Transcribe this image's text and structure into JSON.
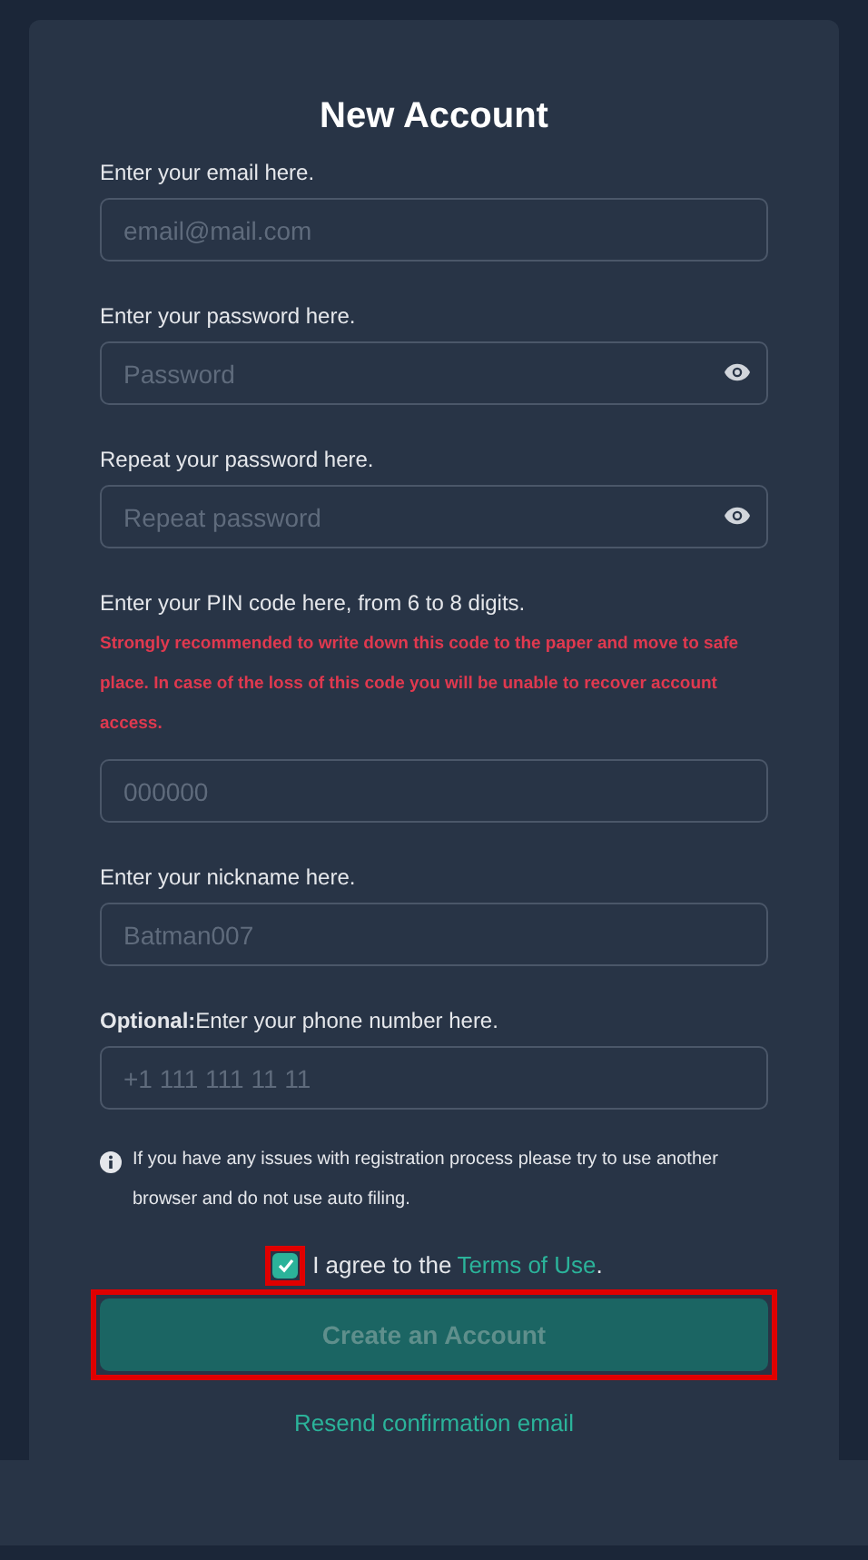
{
  "title": "New Account",
  "fields": [
    {
      "label": "Enter your email here.",
      "placeholder": "email@mail.com",
      "kind": "text"
    },
    {
      "label": "Enter your password here.",
      "placeholder": "Password",
      "kind": "password"
    },
    {
      "label": "Repeat your password here.",
      "placeholder": "Repeat password",
      "kind": "password"
    },
    {
      "label": "Enter your PIN code here, from 6 to 8 digits.",
      "warning": "Strongly recommended to write down this code to the paper and move to safe place. In case of the loss of this code you will be unable to recover account access.",
      "placeholder": "000000",
      "kind": "text"
    },
    {
      "label": "Enter your nickname here.",
      "placeholder": "Batman007",
      "kind": "text"
    },
    {
      "label": "**Optional:**Enter your phone number here.",
      "placeholder": "+1 111 111 11 11",
      "kind": "text"
    }
  ],
  "notice": "If you have any issues with registration process please try to use another browser and do not use auto filing.",
  "agree": {
    "checked": true,
    "highlighted": true,
    "text": "I agree to the",
    "link": "Terms of Use",
    "suffix": "."
  },
  "submit": {
    "label": "Create an Account",
    "highlighted": true
  },
  "resend_link": "Resend confirmation email"
}
